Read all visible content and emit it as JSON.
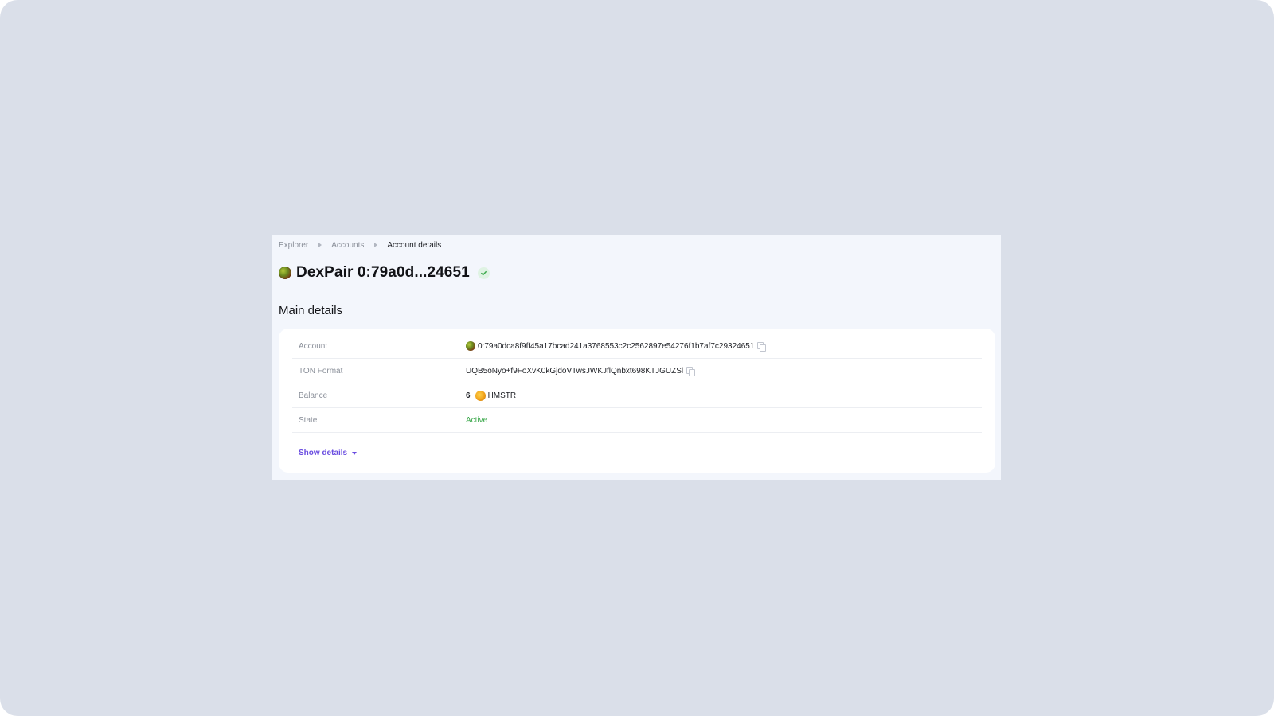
{
  "breadcrumb": {
    "items": [
      "Explorer",
      "Accounts"
    ],
    "current": "Account details"
  },
  "header": {
    "title": "DexPair 0:79a0d...24651",
    "verified": true
  },
  "main_details": {
    "section_title": "Main details",
    "rows": [
      {
        "label": "Account",
        "value": "0:79a0dca8f9ff45a17bcad241a3768553c2c2562897e54276f1b7af7c29324651"
      },
      {
        "label": "TON Format",
        "value": "UQB5oNyo+f9FoXvK0kGjdoVTwsJWKJflQnbxt698KTJGUZSl"
      },
      {
        "label": "Balance",
        "amount": "6",
        "token": "HMSTR"
      },
      {
        "label": "State",
        "value": "Active"
      }
    ],
    "show_details_label": "Show details"
  },
  "colors": {
    "accent": "#6a4de0",
    "active": "#3aa84a",
    "backdrop": "#dadfe9",
    "panel": "#f3f6fc"
  }
}
